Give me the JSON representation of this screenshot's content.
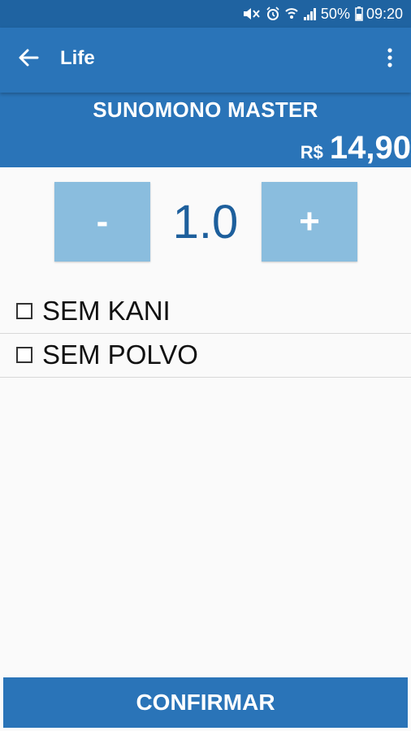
{
  "status_bar": {
    "battery_percent": "50%",
    "time": "09:20",
    "icons": [
      "mute-icon",
      "alarm-icon",
      "wifi-icon",
      "signal-icon",
      "battery-icon"
    ]
  },
  "app_bar": {
    "title": "Life",
    "back_icon": "back-arrow-icon",
    "menu_icon": "more-vert-icon"
  },
  "product": {
    "name": "SUNOMONO MASTER",
    "currency": "R$",
    "price": "14,90"
  },
  "quantity": {
    "minus_label": "-",
    "value": "1.0",
    "plus_label": "+"
  },
  "options": [
    {
      "label": "SEM KANI",
      "checked": false
    },
    {
      "label": "SEM POLVO",
      "checked": false
    }
  ],
  "confirm_button": {
    "label": "CONFIRMAR"
  },
  "colors": {
    "status_bar": "#1f63a1",
    "primary": "#2a74b8",
    "qty_button": "#8abdde",
    "qty_text": "#1d5f9c",
    "background": "#fafafa"
  }
}
